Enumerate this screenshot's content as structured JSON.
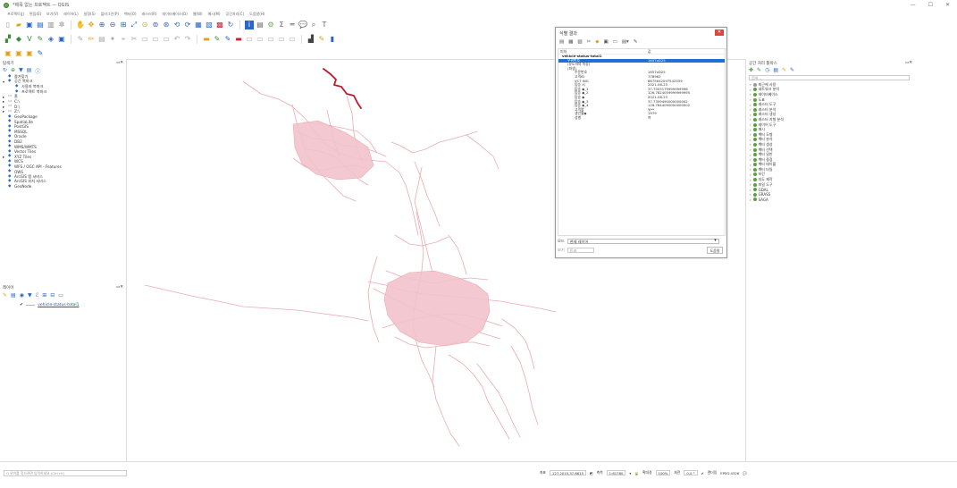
{
  "window": {
    "title": "*제목 없는 프로젝트 — QGIS"
  },
  "menus": [
    "프로젝트(J)",
    "편집(E)",
    "보기(V)",
    "레이어(L)",
    "설정(S)",
    "플러그인(P)",
    "벡터(O)",
    "래스터(R)",
    "데이터베이스(D)",
    "웹(W)",
    "메시(M)",
    "공간처리(C)",
    "도움말(H)"
  ],
  "browser": {
    "title": "탐색기",
    "items": [
      {
        "icon": "star-icon",
        "label": "즐겨찾기",
        "expand": ""
      },
      {
        "icon": "bookmark-icon",
        "label": "공간 북마크",
        "expand": "▾"
      },
      {
        "icon": "bookmark-icon",
        "label": "사용자 북마크",
        "expand": ""
      },
      {
        "icon": "bookmark-icon",
        "label": "프로젝트 북마크",
        "expand": ""
      },
      {
        "icon": "folder-icon",
        "label": "홈",
        "expand": "▸"
      },
      {
        "icon": "folder-icon",
        "label": "C:\\",
        "expand": "▸"
      },
      {
        "icon": "folder-icon",
        "label": "D:\\",
        "expand": "▸"
      },
      {
        "icon": "folder-icon",
        "label": "Z:\\",
        "expand": "▸"
      },
      {
        "icon": "geopackage-icon",
        "label": "GeoPackage",
        "expand": ""
      },
      {
        "icon": "spatialite-icon",
        "label": "SpatiaLite",
        "expand": ""
      },
      {
        "icon": "postgis-icon",
        "label": "PostGIS",
        "expand": ""
      },
      {
        "icon": "mssql-icon",
        "label": "MSSQL",
        "expand": ""
      },
      {
        "icon": "oracle-icon",
        "label": "Oracle",
        "expand": ""
      },
      {
        "icon": "db2-icon",
        "label": "DB2",
        "expand": ""
      },
      {
        "icon": "wms-icon",
        "label": "WMS/WMTS",
        "expand": ""
      },
      {
        "icon": "vector-tiles-icon",
        "label": "Vector Tiles",
        "expand": ""
      },
      {
        "icon": "xyz-tiles-icon",
        "label": "XYZ Tiles",
        "expand": "▸"
      },
      {
        "icon": "wcs-icon",
        "label": "WCS",
        "expand": ""
      },
      {
        "icon": "wfs-icon",
        "label": "WFS / OGC API - Features",
        "expand": ""
      },
      {
        "icon": "ows-icon",
        "label": "OWS",
        "expand": ""
      },
      {
        "icon": "arcgis-icon",
        "label": "ArcGIS 맵 서비스",
        "expand": ""
      },
      {
        "icon": "arcgis-icon",
        "label": "ArcGIS 피처 서비스",
        "expand": ""
      },
      {
        "icon": "geonode-icon",
        "label": "GeoNode",
        "expand": ""
      }
    ]
  },
  "layers_panel": {
    "title": "레이어",
    "layer_name": "vehicle-status-total1"
  },
  "identify": {
    "title": "식별 결과",
    "col_feature": "피처",
    "col_value": "값",
    "layer": "vehicle-status-total1",
    "rows": [
      {
        "k": "우편번호",
        "v": "1657xD25",
        "cls": "sel ind1"
      },
      {
        "k": "(유도하의 속성)",
        "v": "",
        "cls": "ind1"
      },
      {
        "k": "(파생)",
        "v": "",
        "cls": "ind1"
      },
      {
        "k": "주문번호",
        "v": "1657xD25",
        "cls": "ind2"
      },
      {
        "k": "고객ID",
        "v": "778962",
        "cls": "ind2"
      },
      {
        "k": "VCT ING",
        "v": "8675642097542559",
        "cls": "ind2"
      },
      {
        "k": "탑승 시",
        "v": "2021-06-23",
        "cls": "ind2"
      },
      {
        "k": "탑승 ◆_1",
        "v": "37.7053179999999996",
        "cls": "ind2"
      },
      {
        "k": "탑승 ◆_2",
        "v": "126.7824059999999995",
        "cls": "ind2"
      },
      {
        "k": "탑승 ◆",
        "v": "2021-06-23",
        "cls": "ind2"
      },
      {
        "k": "탑승 ◆_3",
        "v": "37.7359490000000002",
        "cls": "ind2"
      },
      {
        "k": "탑승 ◆_4",
        "v": "126.7644090000000002",
        "cls": "ind2"
      },
      {
        "k": "고객명",
        "v": "유**",
        "cls": "ind2"
      },
      {
        "k": "생년월◆",
        "v": "1979",
        "cls": "ind2"
      },
      {
        "k": "성별",
        "v": "여",
        "cls": "ind2"
      }
    ],
    "mode_label": "모드",
    "mode_value": "현재 레이어",
    "view_label": "보기",
    "view_value": "트리",
    "help_label": "도움말"
  },
  "toolbox": {
    "title": "공간 처리 툴박스",
    "search_placeholder": "검색...",
    "items": [
      {
        "label": "최근에 사용",
        "icon": "clock-icon"
      },
      {
        "label": "네트워크 분석",
        "icon": "gear-icon"
      },
      {
        "label": "데이터베이스",
        "icon": "gear-icon"
      },
      {
        "label": "도표",
        "icon": "gear-icon"
      },
      {
        "label": "래스터 도구",
        "icon": "gear-icon"
      },
      {
        "label": "래스터 분석",
        "icon": "gear-icon"
      },
      {
        "label": "래스터 생성",
        "icon": "gear-icon"
      },
      {
        "label": "래스터 지형 분석",
        "icon": "gear-icon"
      },
      {
        "label": "레이어 도구",
        "icon": "gear-icon"
      },
      {
        "label": "메시",
        "icon": "gear-icon"
      },
      {
        "label": "벡터 도형",
        "icon": "gear-icon"
      },
      {
        "label": "벡터 분석",
        "icon": "gear-icon"
      },
      {
        "label": "벡터 생성",
        "icon": "gear-icon"
      },
      {
        "label": "벡터 선택",
        "icon": "gear-icon"
      },
      {
        "label": "벡터 일반",
        "icon": "gear-icon"
      },
      {
        "label": "벡터 중첩",
        "icon": "gear-icon"
      },
      {
        "label": "벡터 테이블",
        "icon": "gear-icon"
      },
      {
        "label": "벡터 타일",
        "icon": "gear-icon"
      },
      {
        "label": "보간",
        "icon": "gear-icon"
      },
      {
        "label": "지도 제작",
        "icon": "gear-icon"
      },
      {
        "label": "파일 도구",
        "icon": "gear-icon"
      },
      {
        "label": "GDAL",
        "icon": "gdal-icon"
      },
      {
        "label": "GRASS",
        "icon": "grass-icon"
      },
      {
        "label": "SAGA",
        "icon": "saga-icon"
      }
    ]
  },
  "status": {
    "locator_placeholder": "Q 위치를 찾으려면 입력하세요 (Ctrl+K)",
    "coord_label": "좌표",
    "coord_value": "127.2015,37.6615",
    "scale_label": "축척",
    "scale_value": "1:61780",
    "magnifier_label": "확대경",
    "magnifier_value": "100%",
    "rotation_label": "회전",
    "rotation_value": "0.0 °",
    "render_label": "렌더링",
    "crs_label": "EPSG:4326"
  },
  "colors": {
    "route": "#e7a1ab",
    "highlight": "#c0182b",
    "selection": "#1e6fd6"
  }
}
